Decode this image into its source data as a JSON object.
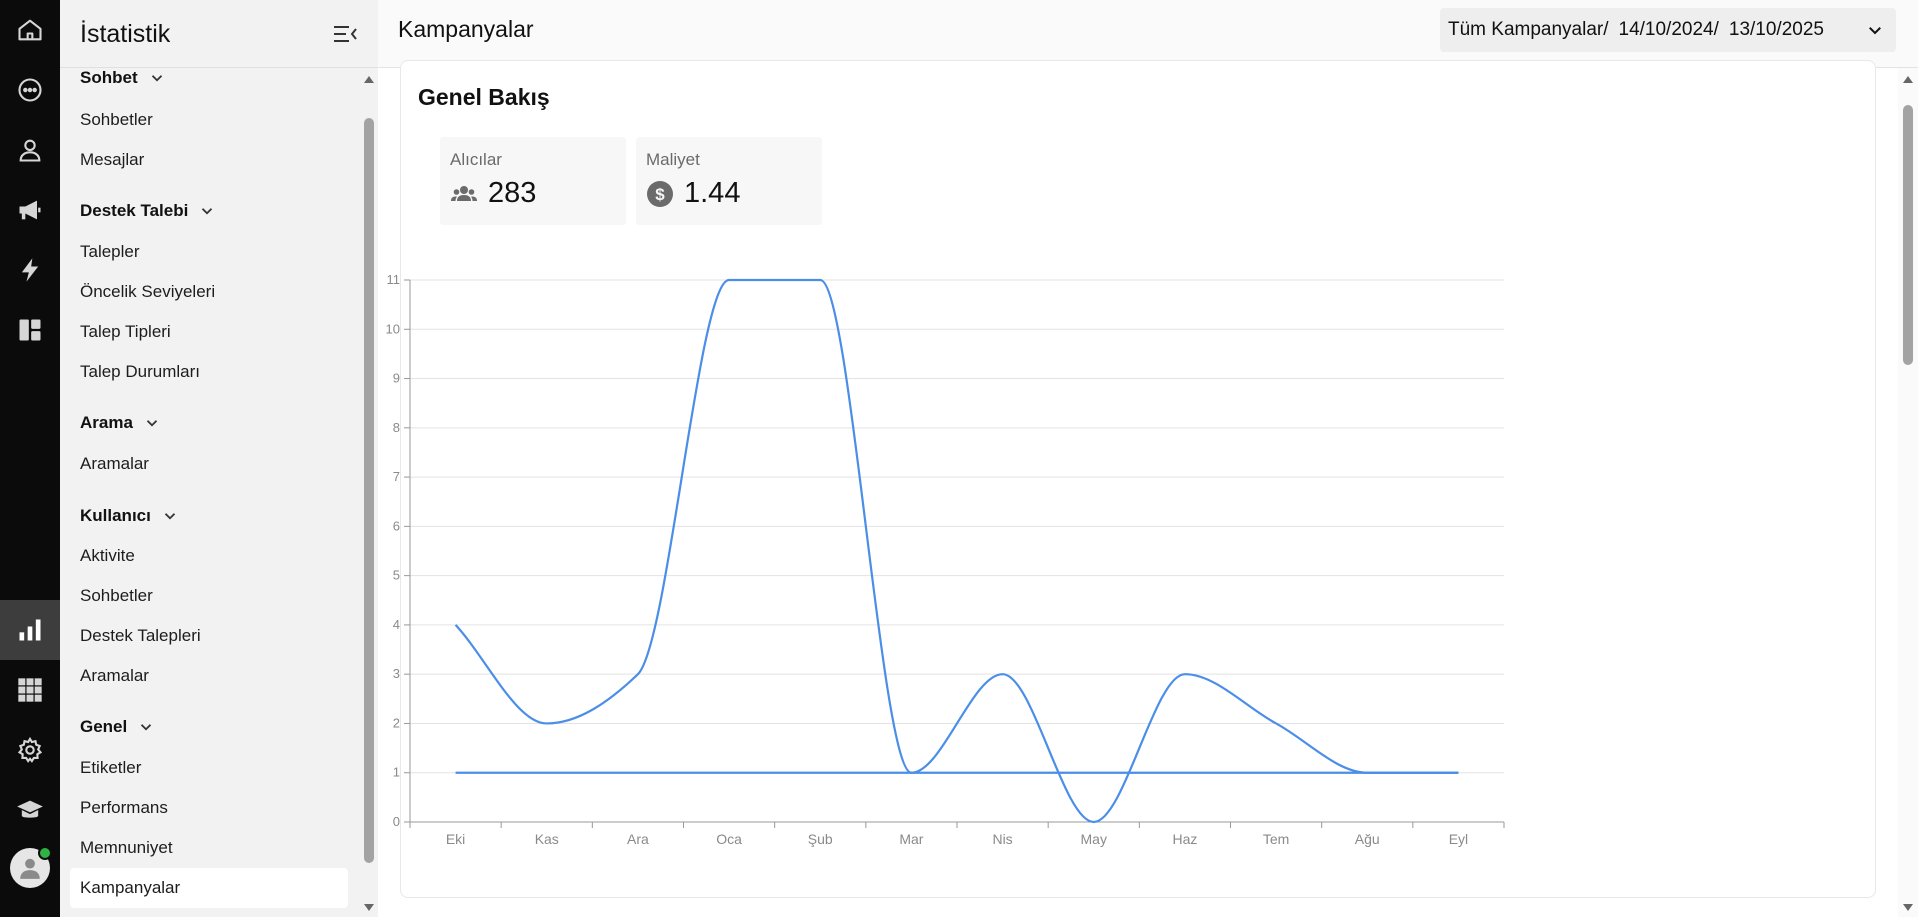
{
  "rail": {
    "icons": [
      "home-icon",
      "chat-icon",
      "user-icon",
      "megaphone-icon",
      "bolt-icon",
      "dashboard-icon",
      "chart-icon",
      "apps-grid-icon",
      "gear-icon",
      "graduation-cap-icon"
    ],
    "active": "chart-icon",
    "colors": {
      "background": "#0b0b0b",
      "icon": "#d6d6d6",
      "active_bg": "#3d3d3d",
      "online": "#2fb344"
    }
  },
  "sidebar": {
    "title": "İstatistik",
    "sections": [
      {
        "title": "Sohbet",
        "items": [
          "Sohbetler",
          "Mesajlar"
        ]
      },
      {
        "title": "Destek Talebi",
        "items": [
          "Talepler",
          "Öncelik Seviyeleri",
          "Talep Tipleri",
          "Talep Durumları"
        ]
      },
      {
        "title": "Arama",
        "items": [
          "Aramalar"
        ]
      },
      {
        "title": "Kullanıcı",
        "items": [
          "Aktivite",
          "Sohbetler",
          "Destek Talepleri",
          "Aramalar"
        ]
      },
      {
        "title": "Genel",
        "items": [
          "Etiketler",
          "Performans",
          "Memnuniyet",
          "Kampanyalar"
        ]
      }
    ],
    "selected": "Kampanyalar"
  },
  "header": {
    "title": "Kampanyalar",
    "filter": {
      "campaign": "Tüm Kampanyalar/",
      "start_date": "14/10/2024/",
      "end_date": "13/10/2025"
    }
  },
  "overview": {
    "title": "Genel Bakış",
    "stats": [
      {
        "label": "Alıcılar",
        "value": "283",
        "icon": "users-icon"
      },
      {
        "label": "Maliyet",
        "value": "1.44",
        "icon": "dollar-circle-icon"
      }
    ]
  },
  "chart_data": {
    "type": "line",
    "categories": [
      "Eki",
      "Kas",
      "Ara",
      "Oca",
      "Şub",
      "Mar",
      "Nis",
      "May",
      "Haz",
      "Tem",
      "Ağu",
      "Eyl"
    ],
    "series": [
      {
        "values": [
          4,
          2,
          3,
          11,
          11,
          1,
          3,
          0,
          3,
          2,
          1,
          1
        ],
        "color": "#4a8ee8"
      },
      {
        "values": [
          1,
          1,
          1,
          1,
          1,
          1,
          1,
          1,
          1,
          1,
          1,
          1
        ],
        "color": "#4a8ee8"
      }
    ],
    "yticks": [
      0,
      1,
      2,
      3,
      4,
      5,
      6,
      7,
      8,
      9,
      10,
      11
    ],
    "ylim": [
      0,
      11
    ],
    "grid": true,
    "legend": "none"
  }
}
